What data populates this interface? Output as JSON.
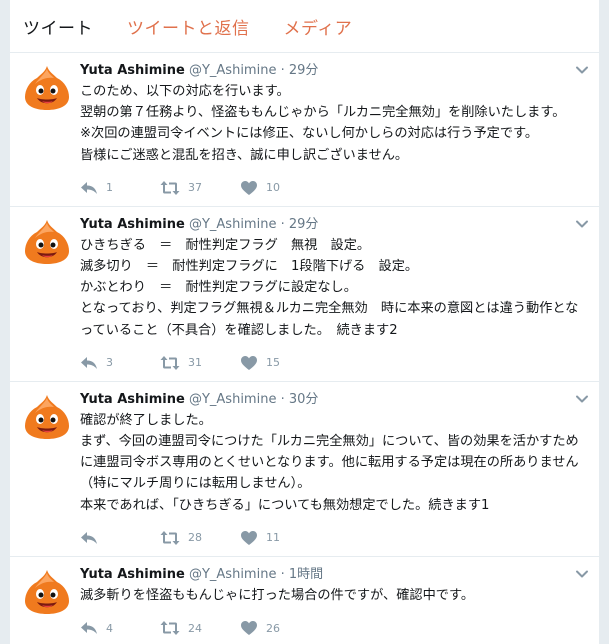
{
  "tabs": [
    {
      "label": "ツイート"
    },
    {
      "label": "ツイートと返信"
    },
    {
      "label": "メディア"
    }
  ],
  "colors": {
    "accent": "#e0714c",
    "meta": "#657786",
    "action": "#8899a6"
  },
  "tweets": [
    {
      "name": "Yuta Ashimine",
      "handle": "@Y_Ashimine",
      "dot": "·",
      "time": "29分",
      "text": "このため、以下の対応を行います。\n翌朝の第７任務より、怪盗ももんじゃから「ルカニ完全無効」を削除いたします。\n※次回の連盟司令イベントには修正、ないし何かしらの対応は行う予定です。\n皆様にご迷惑と混乱を招き、誠に申し訳ございません。",
      "replies": "1",
      "retweets": "37",
      "likes": "10"
    },
    {
      "name": "Yuta Ashimine",
      "handle": "@Y_Ashimine",
      "dot": "·",
      "time": "29分",
      "text": "ひきちぎる　＝　耐性判定フラグ　無視　設定。\n滅多切り　＝　耐性判定フラグに　1段階下げる　設定。\nかぶとわり　＝　耐性判定フラグに設定なし。\nとなっており、判定フラグ無視＆ルカニ完全無効　時に本来の意図とは違う動作となっていること（不具合）を確認しました。　続きます2",
      "replies": "3",
      "retweets": "31",
      "likes": "15"
    },
    {
      "name": "Yuta Ashimine",
      "handle": "@Y_Ashimine",
      "dot": "·",
      "time": "30分",
      "text": "確認が終了しました。\nまず、今回の連盟司令につけた「ルカニ完全無効」について、皆の効果を活かすために連盟司令ボス専用のとくせいとなります。他に転用する予定は現在の所ありません（特にマルチ周りには転用しません）。\n本来であれば、「ひきちぎる」についても無効想定でした。続きます1",
      "replies": "",
      "retweets": "28",
      "likes": "11"
    },
    {
      "name": "Yuta Ashimine",
      "handle": "@Y_Ashimine",
      "dot": "·",
      "time": "1時間",
      "text": "滅多斬りを怪盗ももんじゃに打った場合の件ですが、確認中です。",
      "replies": "4",
      "retweets": "24",
      "likes": "26"
    }
  ]
}
